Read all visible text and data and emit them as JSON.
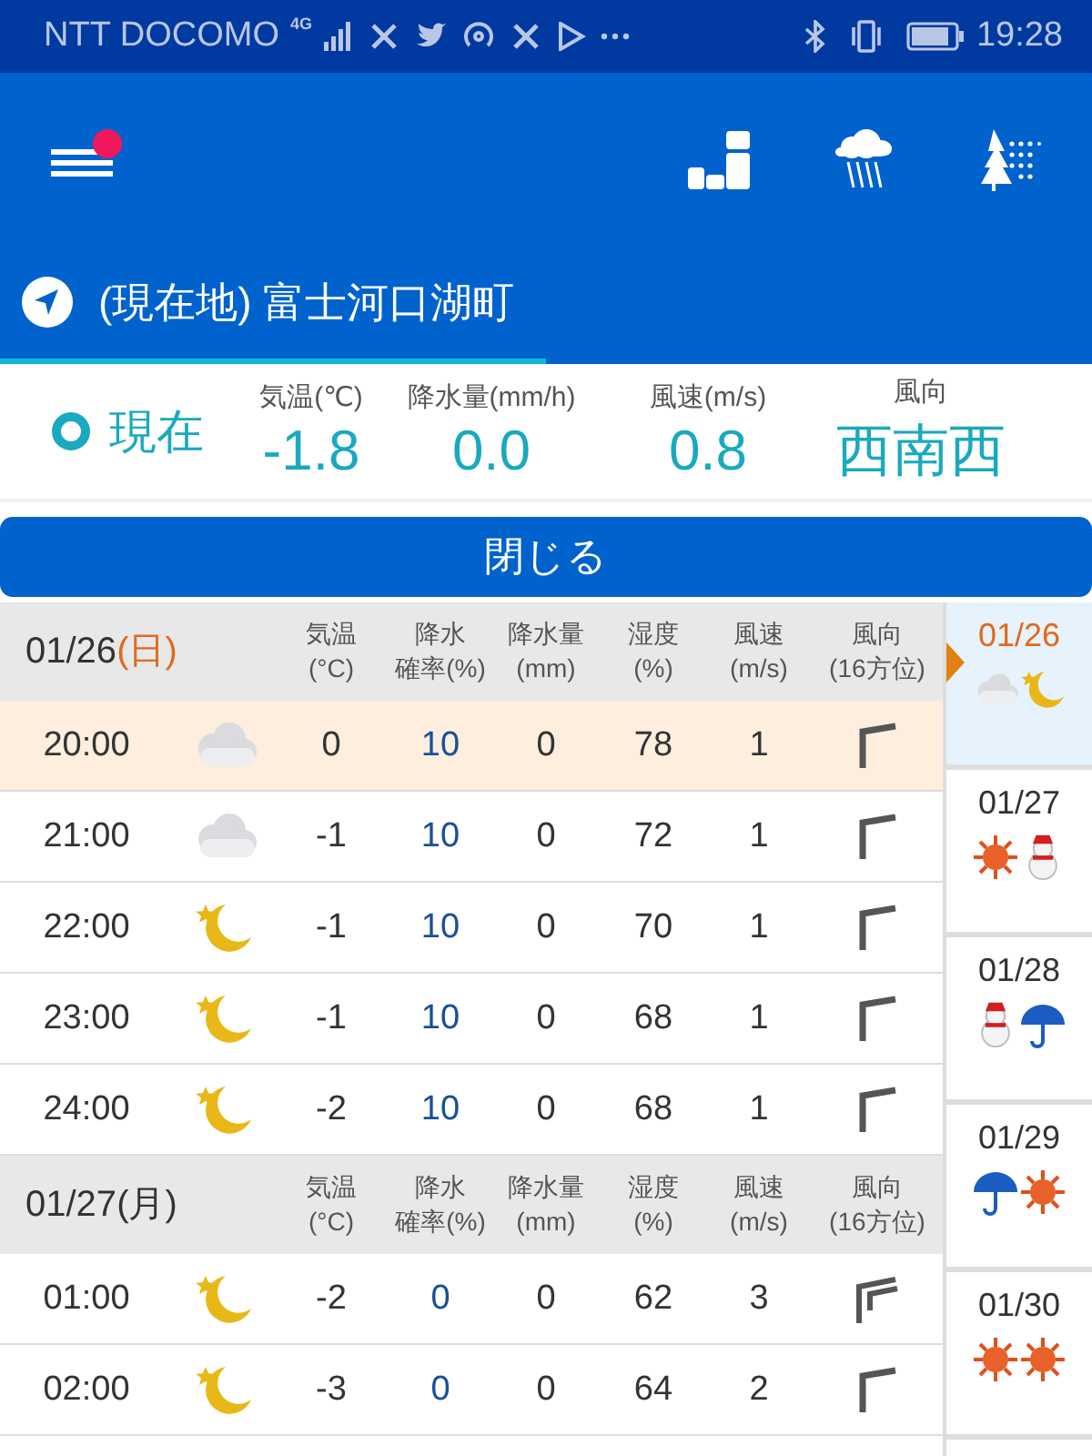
{
  "status_bar": {
    "carrier": "NTT DOCOMO",
    "network": "4G",
    "time": "19:28"
  },
  "app_bar": {
    "menu_badge": true
  },
  "location": {
    "name": "(現在地) 富士河口湖町"
  },
  "now": {
    "label": "現在",
    "metrics": [
      {
        "label": "気温(℃)",
        "value": "-1.8"
      },
      {
        "label": "降水量(mm/h)",
        "value": "0.0"
      },
      {
        "label": "風速(m/s)",
        "value": "0.8"
      },
      {
        "label": "風向",
        "value": "西南西"
      }
    ]
  },
  "close_button": "閉じる",
  "groups": [
    {
      "date": "01/26",
      "weekday": "(日)",
      "color": "#e06a1e",
      "columns": [
        {
          "top": "気温",
          "bottom": "(°C)"
        },
        {
          "top": "降水",
          "bottom": "確率(%)"
        },
        {
          "top": "降水量",
          "bottom": "(mm)"
        },
        {
          "top": "湿度",
          "bottom": "(%)"
        },
        {
          "top": "風速",
          "bottom": "(m/s)"
        },
        {
          "top": "風向",
          "bottom": "(16方位)"
        }
      ],
      "rows": [
        {
          "time": "20:00",
          "weather": {
            "kind": "cloud"
          },
          "temp": "0",
          "prob": "10",
          "amount": "0",
          "humidity": "78",
          "wind": "1",
          "current": true,
          "wind_icon": {
            "kind": "single"
          }
        },
        {
          "time": "21:00",
          "weather": {
            "kind": "cloud"
          },
          "temp": "-1",
          "prob": "10",
          "amount": "0",
          "humidity": "72",
          "wind": "1",
          "current": false,
          "wind_icon": {
            "kind": "single"
          }
        },
        {
          "time": "22:00",
          "weather": {
            "kind": "moon"
          },
          "temp": "-1",
          "prob": "10",
          "amount": "0",
          "humidity": "70",
          "wind": "1",
          "current": false,
          "wind_icon": {
            "kind": "single"
          }
        },
        {
          "time": "23:00",
          "weather": {
            "kind": "moon"
          },
          "temp": "-1",
          "prob": "10",
          "amount": "0",
          "humidity": "68",
          "wind": "1",
          "current": false,
          "wind_icon": {
            "kind": "single"
          }
        },
        {
          "time": "24:00",
          "weather": {
            "kind": "moon"
          },
          "temp": "-2",
          "prob": "10",
          "amount": "0",
          "humidity": "68",
          "wind": "1",
          "current": false,
          "wind_icon": {
            "kind": "single"
          }
        }
      ]
    },
    {
      "date": "01/27",
      "weekday": "(月)",
      "color": "#333333",
      "columns": [
        {
          "top": "気温",
          "bottom": "(°C)"
        },
        {
          "top": "降水",
          "bottom": "確率(%)"
        },
        {
          "top": "降水量",
          "bottom": "(mm)"
        },
        {
          "top": "湿度",
          "bottom": "(%)"
        },
        {
          "top": "風速",
          "bottom": "(m/s)"
        },
        {
          "top": "風向",
          "bottom": "(16方位)"
        }
      ],
      "rows": [
        {
          "time": "01:00",
          "weather": {
            "kind": "moon"
          },
          "temp": "-2",
          "prob": "0",
          "amount": "0",
          "humidity": "62",
          "wind": "3",
          "current": false,
          "wind_icon": {
            "kind": "double"
          }
        },
        {
          "time": "02:00",
          "weather": {
            "kind": "moon"
          },
          "temp": "-3",
          "prob": "0",
          "amount": "0",
          "humidity": "64",
          "wind": "2",
          "current": false,
          "wind_icon": {
            "kind": "single"
          }
        }
      ]
    }
  ],
  "days": [
    {
      "date": "01/26",
      "selected": true,
      "from": {
        "kind": "cloud"
      },
      "to": {
        "kind": "moon"
      }
    },
    {
      "date": "01/27",
      "selected": false,
      "from": {
        "kind": "sun"
      },
      "to": {
        "kind": "snowman"
      }
    },
    {
      "date": "01/28",
      "selected": false,
      "from": {
        "kind": "snowman"
      },
      "to": {
        "kind": "umbrella"
      }
    },
    {
      "date": "01/29",
      "selected": false,
      "from": {
        "kind": "umbrella"
      },
      "to": {
        "kind": "sun"
      }
    },
    {
      "date": "01/30",
      "selected": false,
      "from": {
        "kind": "sun"
      },
      "to": {
        "kind": "sun"
      }
    }
  ]
}
